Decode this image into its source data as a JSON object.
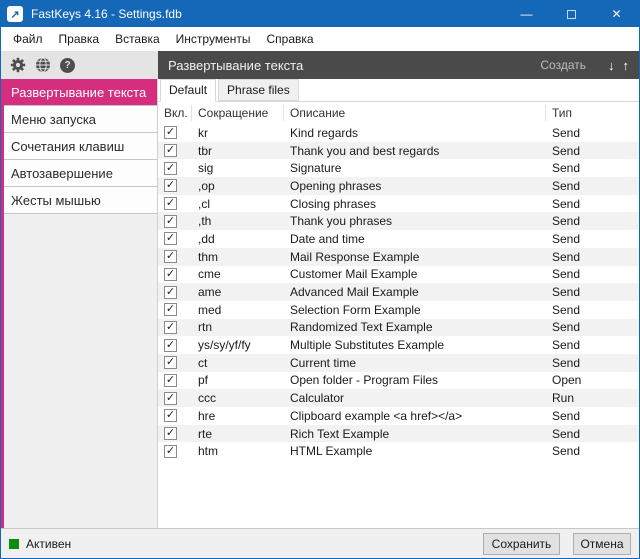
{
  "window": {
    "title": "FastKeys 4.16 - Settings.fdb",
    "icon_glyph": "↗",
    "minimize_glyph": "—",
    "close_glyph": "✕"
  },
  "menu": {
    "items": [
      "Файл",
      "Правка",
      "Вставка",
      "Инструменты",
      "Справка"
    ]
  },
  "toolbar": {
    "help_glyph": "?"
  },
  "header": {
    "title": "Развертывание текста",
    "create_label": "Создать",
    "move_down_glyph": "↓",
    "move_up_glyph": "↑"
  },
  "sidebar": {
    "items": [
      {
        "label": "Развертывание текста",
        "active": true
      },
      {
        "label": "Меню запуска"
      },
      {
        "label": "Сочетания клавиш"
      },
      {
        "label": "Автозавершение"
      },
      {
        "label": "Жесты мышью"
      }
    ]
  },
  "tabs": [
    {
      "label": "Default",
      "active": true
    },
    {
      "label": "Phrase files"
    }
  ],
  "table": {
    "check_glyph": "✓",
    "columns": [
      "Вкл.",
      "Сокращение",
      "Описание",
      "Тип"
    ],
    "rows": [
      {
        "checked": true,
        "abbr": "kr",
        "desc": "Kind regards",
        "type": "Send"
      },
      {
        "checked": true,
        "abbr": "tbr",
        "desc": "Thank you and best regards",
        "type": "Send"
      },
      {
        "checked": true,
        "abbr": "sig",
        "desc": "Signature",
        "type": "Send"
      },
      {
        "checked": true,
        "abbr": ",op",
        "desc": "Opening phrases",
        "type": "Send"
      },
      {
        "checked": true,
        "abbr": ",cl",
        "desc": "Closing phrases",
        "type": "Send"
      },
      {
        "checked": true,
        "abbr": ",th",
        "desc": "Thank you phrases",
        "type": "Send"
      },
      {
        "checked": true,
        "abbr": ",dd",
        "desc": "Date and time",
        "type": "Send"
      },
      {
        "checked": true,
        "abbr": "thm",
        "desc": "Mail Response Example",
        "type": "Send"
      },
      {
        "checked": true,
        "abbr": "cme",
        "desc": "Customer Mail Example",
        "type": "Send"
      },
      {
        "checked": true,
        "abbr": "ame",
        "desc": "Advanced Mail Example",
        "type": "Send"
      },
      {
        "checked": true,
        "abbr": "med",
        "desc": "Selection Form Example",
        "type": "Send"
      },
      {
        "checked": true,
        "abbr": "rtn",
        "desc": "Randomized Text Example",
        "type": "Send"
      },
      {
        "checked": true,
        "abbr": "ys/sy/yf/fy",
        "desc": "Multiple Substitutes Example",
        "type": "Send"
      },
      {
        "checked": true,
        "abbr": "ct",
        "desc": "Current time",
        "type": "Send"
      },
      {
        "checked": true,
        "abbr": "pf",
        "desc": "Open folder - Program Files",
        "type": "Open"
      },
      {
        "checked": true,
        "abbr": "ccc",
        "desc": "Calculator",
        "type": "Run"
      },
      {
        "checked": true,
        "abbr": "hre",
        "desc": "Clipboard example <a href></a>",
        "type": "Send"
      },
      {
        "checked": true,
        "abbr": "rte",
        "desc": "Rich Text Example",
        "type": "Send"
      },
      {
        "checked": true,
        "abbr": "htm",
        "desc": "HTML Example",
        "type": "Send"
      }
    ]
  },
  "status": {
    "label": "Активен",
    "dot_style": "background:#0e8c0e"
  },
  "footer": {
    "save_label": "Сохранить",
    "cancel_label": "Отмена"
  },
  "colors": {
    "titlebar_blue": "#1567b8",
    "accent_pink": "#d52e7e",
    "header_dark": "#4a4a4a",
    "status_green": "#0e8c0e"
  }
}
